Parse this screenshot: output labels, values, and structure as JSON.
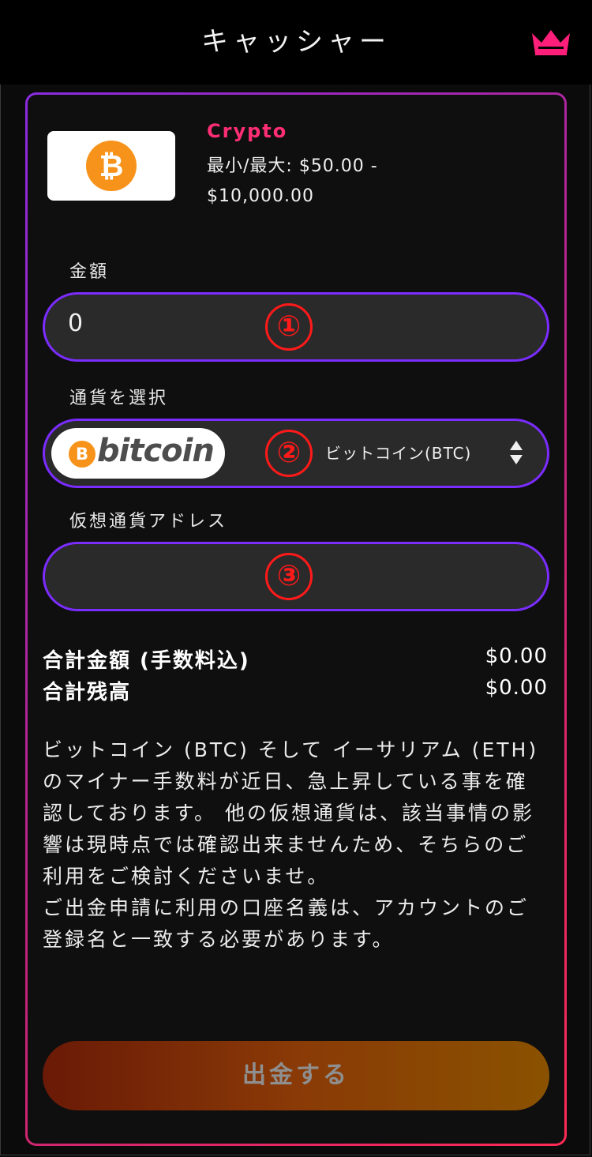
{
  "header": {
    "title": "キャッシャー",
    "logo_icon": "crown-icon"
  },
  "method": {
    "name": "Crypto",
    "range": "最小/最大: $50.00 - $10,000.00",
    "icon": "bitcoin-icon",
    "symbol": "₿"
  },
  "form": {
    "amount_label": "金額",
    "amount_value": "0",
    "currency_label": "通貨を選択",
    "currency_logo_symbol": "B",
    "currency_logo_text": "bitcoin",
    "currency_selected": "ビットコイン(BTC)",
    "address_label": "仮想通貨アドレス",
    "address_value": ""
  },
  "callouts": {
    "one": "①",
    "two": "②",
    "three": "③"
  },
  "totals": {
    "amount_label": "合計金額 (手数料込)",
    "amount_value": "$0.00",
    "balance_label": "合計残高",
    "balance_value": "$0.00"
  },
  "notice": {
    "paragraph1": "ビットコイン (BTC) そして イーサリアム (ETH) のマイナー手数料が近日、急上昇している事を確認しております。 他の仮想通貨は、該当事情の影響は現時点では確認出来ませんため、そちらのご利用をご検討くださいませ。",
    "paragraph2": "ご出金申請に利用の口座名義は、アカウントのご登録名と一致する必要があります。"
  },
  "submit_label": "出金する",
  "colors": {
    "accent_pink": "#ff2e74",
    "border_purple": "#7b2cff",
    "bitcoin_orange": "#f7931a",
    "callout_red": "#ff1a1a"
  }
}
